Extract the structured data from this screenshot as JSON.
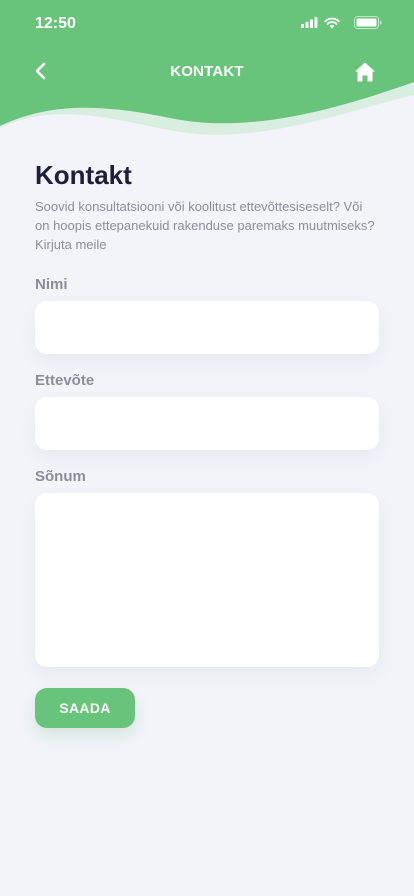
{
  "status_bar": {
    "time": "12:50"
  },
  "header": {
    "title": "KONTAKT",
    "back_icon": "chevron-left-icon",
    "home_icon": "home-icon",
    "color": "#68c47a",
    "wave_color": "#d9eee0"
  },
  "main": {
    "title": "Kontakt",
    "description": "Soovid konsultatsiooni või koolitust ettevõttesiseselt? Või on hoopis ettepanekuid rakenduse paremaks muutmiseks? Kirjuta meile"
  },
  "form": {
    "name_label": "Nimi",
    "name_value": "",
    "company_label": "Ettevõte",
    "company_value": "",
    "message_label": "Sõnum",
    "message_value": "",
    "submit_label": "SAADA"
  }
}
